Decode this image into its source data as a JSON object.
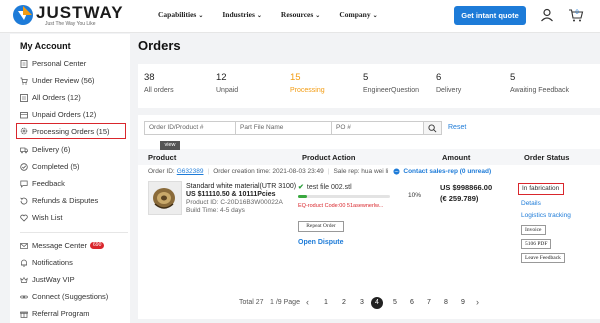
{
  "header": {
    "brand": "JUSTWAY",
    "tagline": "Just The Way You Like",
    "nav": [
      "Capabilities",
      "Industries",
      "Resources",
      "Company"
    ],
    "cta": "Get intant quote",
    "cart_count": "0",
    "brand_color": "#1d7bd8"
  },
  "sidebar": {
    "title": "My Account",
    "items": [
      {
        "label": "Personal Center",
        "icon": "document-icon"
      },
      {
        "label": "Under Review (56)",
        "icon": "cart-icon"
      },
      {
        "label": "All Orders (12)",
        "icon": "list-icon"
      },
      {
        "label": "Unpaid Orders (12)",
        "icon": "wallet-icon"
      },
      {
        "label": "Processing Orders (15)",
        "icon": "gear-icon"
      },
      {
        "label": "Delivery (6)",
        "icon": "truck-icon"
      },
      {
        "label": "Completed (5)",
        "icon": "check-circle-icon"
      },
      {
        "label": "Feedback",
        "icon": "chat-icon"
      },
      {
        "label": "Refunds & Disputes",
        "icon": "refund-icon"
      },
      {
        "label": "Wish List",
        "icon": "heart-icon"
      }
    ],
    "items2": [
      {
        "label": "Message Center",
        "icon": "mail-icon",
        "badge": "690"
      },
      {
        "label": "Notifications",
        "icon": "bell-icon"
      },
      {
        "label": "JustWay VIP",
        "icon": "vip-icon"
      },
      {
        "label": "Connect (Suggestions)",
        "icon": "link-icon"
      },
      {
        "label": "Referral Program",
        "icon": "gift-icon"
      }
    ]
  },
  "main": {
    "title": "Orders",
    "stats": [
      {
        "num": "38",
        "label": "All orders"
      },
      {
        "num": "12",
        "label": "Unpaid"
      },
      {
        "num": "15",
        "label": "Processing"
      },
      {
        "num": "5",
        "label": "EngineerQuestion"
      },
      {
        "num": "6",
        "label": "Delivery"
      },
      {
        "num": "5",
        "label": "Awaiting Feedback"
      }
    ],
    "filters": {
      "order_placeholder": "Order ID/Product #",
      "part_placeholder": "Part File Name",
      "po_placeholder": "PO #",
      "reset": "Reset"
    },
    "table_headers": [
      "Product",
      "Product Action",
      "Amount",
      "Order Status"
    ],
    "order": {
      "id_label": "Order ID:",
      "id": "G632389",
      "created": "Order creation time: 2021-08-03 23:49",
      "sales": "Sale rep: hua wei li",
      "contact": "Contact sales-rep (0 unread)",
      "view": "view",
      "material": "Standard white material(UTR 3100)",
      "price_line": "US $11110.50 & 10111Pcies",
      "product_id": "Product ID: C-20D16B3W00022A",
      "build_time": "Build Time: 4-5 days",
      "file": "test file 002.stl",
      "progress_pct": "10%",
      "progress_value": 0.1,
      "eq_code": "EQ-roduct Code:00 51asewnerlw...",
      "repeat": "Repeat Order",
      "dispute": "Open Dispute",
      "amount_usd": "US $998866.00",
      "amount_eur": "(€ 259.789)",
      "status": "In fabrication",
      "details": "Details",
      "tracking": "Logistics tracking",
      "invoice": "Invoice",
      "pdf": "5106 PDF",
      "feedback": "Leave Feedback"
    },
    "pager": {
      "total": "Total 27",
      "of": "1 /9 Page",
      "pages": [
        "1",
        "2",
        "3",
        "4",
        "5",
        "6",
        "7",
        "8",
        "9"
      ],
      "current": "4"
    }
  }
}
